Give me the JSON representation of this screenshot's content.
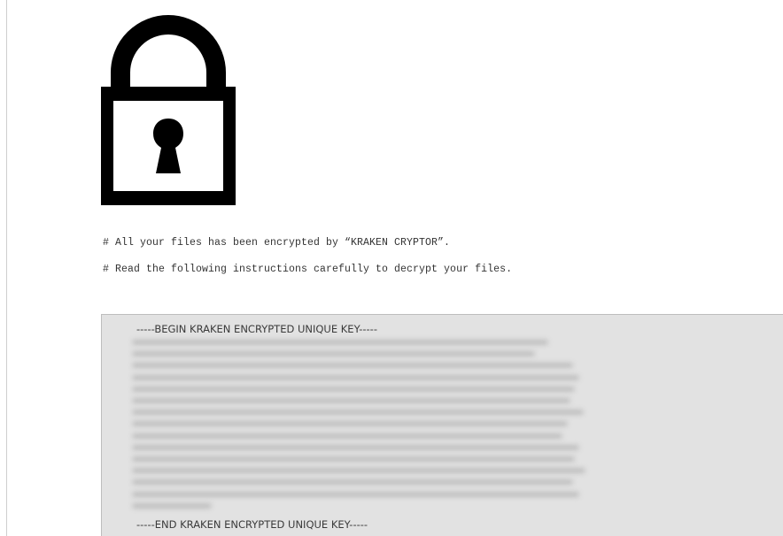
{
  "icon": {
    "name": "padlock-icon",
    "color": "#000000",
    "background": "#ffffff"
  },
  "message": {
    "line1": "# All your files has been encrypted by “KRAKEN CRYPTOR”.",
    "line2": "# Read the following instructions carefully to decrypt your files."
  },
  "key_block": {
    "header": "-----BEGIN KRAKEN ENCRYPTED UNIQUE KEY-----",
    "footer": "-----END KRAKEN ENCRYPTED UNIQUE KEY-----",
    "background": "#e2e2e2"
  }
}
